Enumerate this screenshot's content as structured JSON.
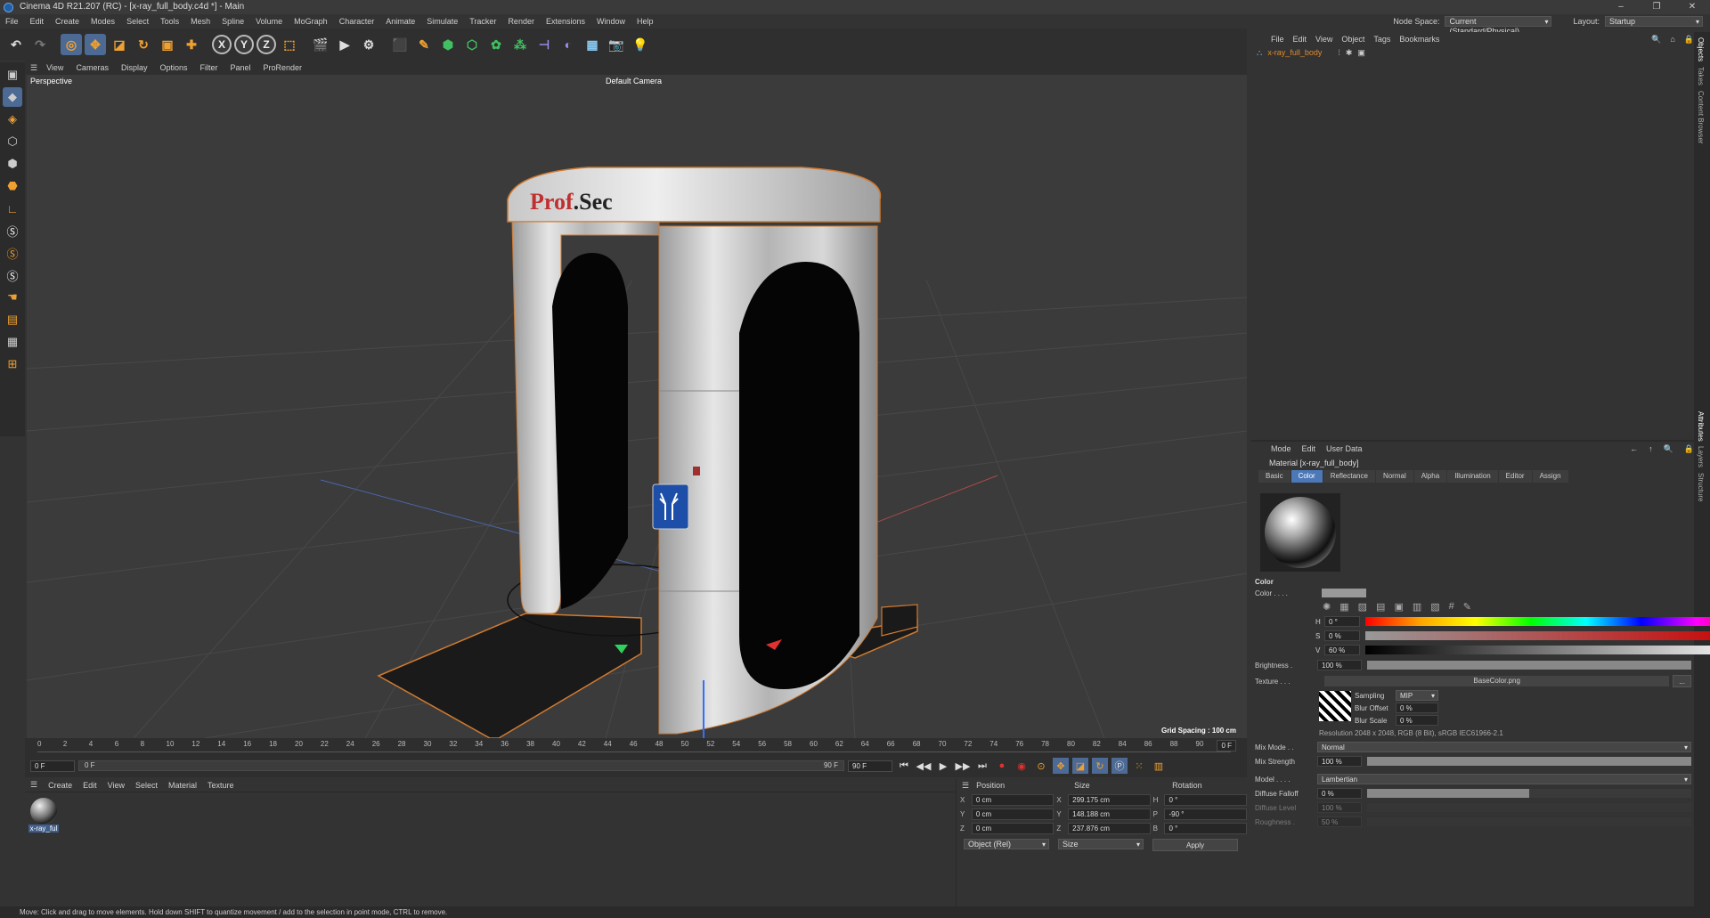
{
  "window": {
    "title": "Cinema 4D R21.207 (RC) - [x-ray_full_body.c4d *] - Main",
    "min": "–",
    "max": "❐",
    "close": "✕"
  },
  "menu": [
    "File",
    "Edit",
    "Create",
    "Modes",
    "Select",
    "Tools",
    "Mesh",
    "Spline",
    "Volume",
    "MoGraph",
    "Character",
    "Animate",
    "Simulate",
    "Tracker",
    "Render",
    "Extensions",
    "Window",
    "Help"
  ],
  "nodespace": {
    "label": "Node Space:",
    "value": "Current (Standard/Physical)",
    "layout_label": "Layout:",
    "layout_value": "Startup"
  },
  "viewport": {
    "menu": [
      "View",
      "Cameras",
      "Display",
      "Options",
      "Filter",
      "Panel",
      "ProRender"
    ],
    "label": "Perspective",
    "camera": "Default Camera",
    "grid": "Grid Spacing : 100 cm",
    "brand_a": "Prof",
    "brand_b": ".Sec"
  },
  "timeline": {
    "ticks": [
      "0",
      "2",
      "4",
      "6",
      "8",
      "10",
      "12",
      "14",
      "16",
      "18",
      "20",
      "22",
      "24",
      "26",
      "28",
      "30",
      "32",
      "34",
      "36",
      "38",
      "40",
      "42",
      "44",
      "46",
      "48",
      "50",
      "52",
      "54",
      "56",
      "58",
      "60",
      "62",
      "64",
      "66",
      "68",
      "70",
      "72",
      "74",
      "76",
      "78",
      "80",
      "82",
      "84",
      "86",
      "88",
      "90"
    ],
    "frame_end": "0 F",
    "start": "0 F",
    "start2": "0 F",
    "end": "90 F",
    "end2": "90 F"
  },
  "materials": {
    "menu": [
      "Create",
      "Edit",
      "View",
      "Select",
      "Material",
      "Texture"
    ],
    "item": "x-ray_ful"
  },
  "coords": {
    "position": "Position",
    "size": "Size",
    "rotation": "Rotation",
    "px": "0 cm",
    "py": "0 cm",
    "pz": "0 cm",
    "sx": "299.175 cm",
    "sy": "148.188 cm",
    "sz": "237.876 cm",
    "rh": "0 °",
    "rp": "-90 °",
    "rb": "0 °",
    "mode": "Object (Rel)",
    "size_mode": "Size",
    "apply": "Apply"
  },
  "objects": {
    "menu": [
      "File",
      "Edit",
      "View",
      "Object",
      "Tags",
      "Bookmarks"
    ],
    "item": "x-ray_full_body"
  },
  "attributes": {
    "menu": [
      "Mode",
      "Edit",
      "User Data"
    ],
    "title": "Material [x-ray_full_body]",
    "tabs": [
      "Basic",
      "Color",
      "Reflectance",
      "Normal",
      "Alpha",
      "Illumination",
      "Editor",
      "Assign"
    ],
    "active_tab": "Color",
    "section": "Color",
    "color_label": "Color . . . .",
    "h": "0 °",
    "s": "0 %",
    "v": "60 %",
    "brightness_label": "Brightness .",
    "brightness": "100 %",
    "texture_label": "Texture . . .",
    "texture_file": "BaseColor.png",
    "sampling_label": "Sampling",
    "sampling": "MIP",
    "blur_offset_label": "Blur Offset",
    "blur_offset": "0 %",
    "blur_scale_label": "Blur Scale",
    "blur_scale": "0 %",
    "resolution": "Resolution 2048 x 2048, RGB (8 Bit), sRGB IEC61966-2.1",
    "mix_mode_label": "Mix Mode . .",
    "mix_mode": "Normal",
    "mix_strength_label": "Mix Strength",
    "mix_strength": "100 %",
    "model_label": "Model . . . .",
    "model": "Lambertian",
    "diffuse_falloff_label": "Diffuse Falloff",
    "diffuse_falloff": "0 %",
    "diffuse_level_label": "Diffuse Level",
    "diffuse_level": "100 %",
    "roughness_label": "Roughness .",
    "roughness": "50 %"
  },
  "side_tabs": [
    "Objects",
    "Takes",
    "Content Browser"
  ],
  "side_tabs2": [
    "Attributes",
    "Layers",
    "Structure"
  ],
  "status": "Move: Click and drag to move elements. Hold down SHIFT to quantize movement / add to the selection in point mode, CTRL to remove."
}
